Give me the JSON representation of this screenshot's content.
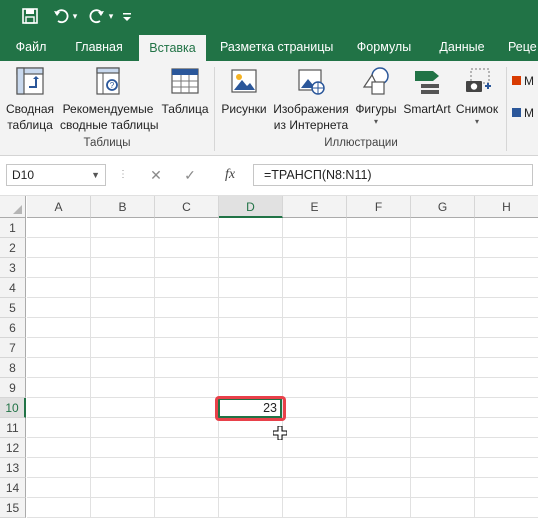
{
  "quick_access": {
    "save_icon": "save-icon",
    "undo_icon": "undo-icon",
    "redo_icon": "redo-icon",
    "customize_icon": "customize-icon"
  },
  "tabs": [
    {
      "label": "Файл"
    },
    {
      "label": "Главная"
    },
    {
      "label": "Вставка",
      "active": true
    },
    {
      "label": "Разметка страницы"
    },
    {
      "label": "Формулы"
    },
    {
      "label": "Данные"
    },
    {
      "label": "Реце"
    }
  ],
  "ribbon": {
    "groups": [
      {
        "label": "Таблицы"
      },
      {
        "label": "Иллюстрации"
      }
    ],
    "buttons": {
      "pivot_line1": "Сводная",
      "pivot_line2": "таблица",
      "rec_pivot_line1": "Рекомендуемые",
      "rec_pivot_line2": "сводные таблицы",
      "table": "Таблица",
      "pictures": "Рисунки",
      "online_line1": "Изображения",
      "online_line2": "из Интернета",
      "shapes": "Фигуры",
      "smartart": "SmartArt",
      "screenshot": "Снимок",
      "store_cut": "М",
      "addins_cut": "М"
    }
  },
  "formula_bar": {
    "name_box": "D10",
    "fx": "fx",
    "formula": "=ТРАНСП(N8:N11)"
  },
  "sheet": {
    "columns": [
      "A",
      "B",
      "C",
      "D",
      "E",
      "F",
      "G",
      "H"
    ],
    "rows": [
      "1",
      "2",
      "3",
      "4",
      "5",
      "6",
      "7",
      "8",
      "9",
      "10",
      "11",
      "12",
      "13",
      "14",
      "15"
    ],
    "selected_column": "D",
    "selected_row": "10",
    "d10_value": "23"
  },
  "colors": {
    "brand": "#217346",
    "highlight": "#e8414a"
  }
}
